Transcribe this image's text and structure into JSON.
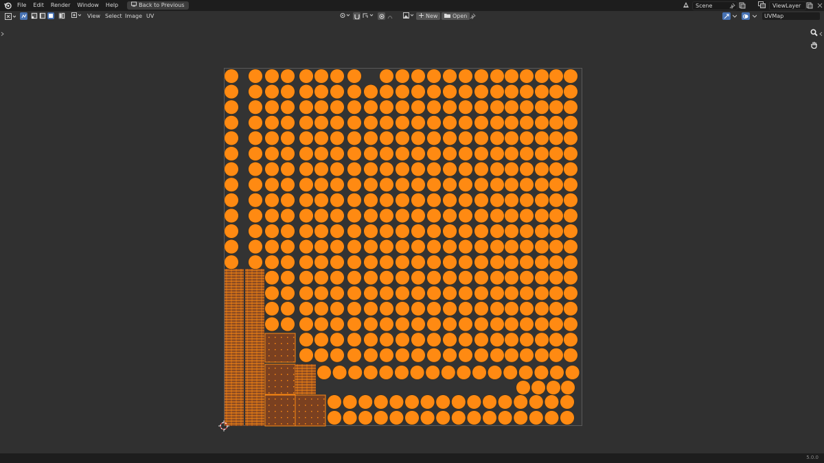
{
  "topbar": {
    "menus": [
      "File",
      "Edit",
      "Render",
      "Window",
      "Help"
    ],
    "back_label": "Back to Previous",
    "scene_name": "Scene",
    "view_layer_name": "ViewLayer"
  },
  "header": {
    "menus": [
      "View",
      "Select",
      "Image",
      "UV"
    ],
    "new_label": "New",
    "open_label": "Open",
    "uv_map_name": "UVMap",
    "select_modes": [
      "vertex",
      "edge",
      "face",
      "island"
    ],
    "active_select_mode": "face",
    "sync_selection": true
  },
  "viewport": {
    "tools": [
      "zoom-icon",
      "hand-pan-icon"
    ]
  },
  "status": {
    "version": "5.0.0"
  },
  "colors": {
    "uv_selected_face": "#ff8a12",
    "uv_edge": "#3a2a12",
    "uv_grid_dark": "#8a4a22",
    "uv_bounds": "#5a5a5a",
    "viewport_bg": "#303030",
    "accent": "#4772b3"
  }
}
